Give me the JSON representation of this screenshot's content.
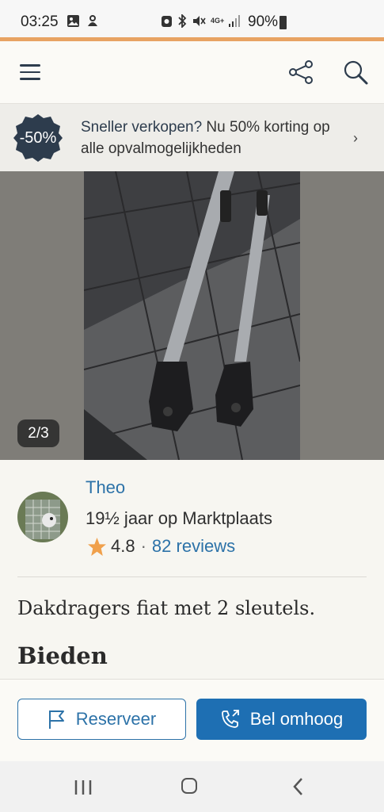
{
  "status_bar": {
    "time": "03:25",
    "network": "4G+",
    "battery": "90%",
    "left_icons": [
      "image-icon",
      "notification-icon"
    ],
    "right_icons": [
      "app-icon",
      "bluetooth-icon",
      "mute-icon",
      "network-icon",
      "signal-icon"
    ]
  },
  "header": {
    "menu_icon": "hamburger-icon",
    "share_icon": "share-icon",
    "search_icon": "search-icon"
  },
  "promo": {
    "badge": "-50%",
    "text_bold": "Sneller verkopen?",
    "text_rest": " Nu 50% korting op alle opvalmogelijkheden",
    "chevron": "›"
  },
  "gallery": {
    "counter": "2/3"
  },
  "seller": {
    "name": "Theo",
    "years": "19½ jaar op Marktplaats",
    "rating": "4.8",
    "separator": "·",
    "reviews": "82 reviews"
  },
  "listing": {
    "title": "Dakdragers fiat met 2 sleutels.",
    "price": "Bieden"
  },
  "actions": {
    "reserve_label": "Reserveer",
    "call_label": "Bel omhoog"
  },
  "colors": {
    "accent_blue": "#2c72a8",
    "button_blue": "#1e6fb3",
    "orange": "#e8a363",
    "badge_dark": "#2d3c4d"
  }
}
